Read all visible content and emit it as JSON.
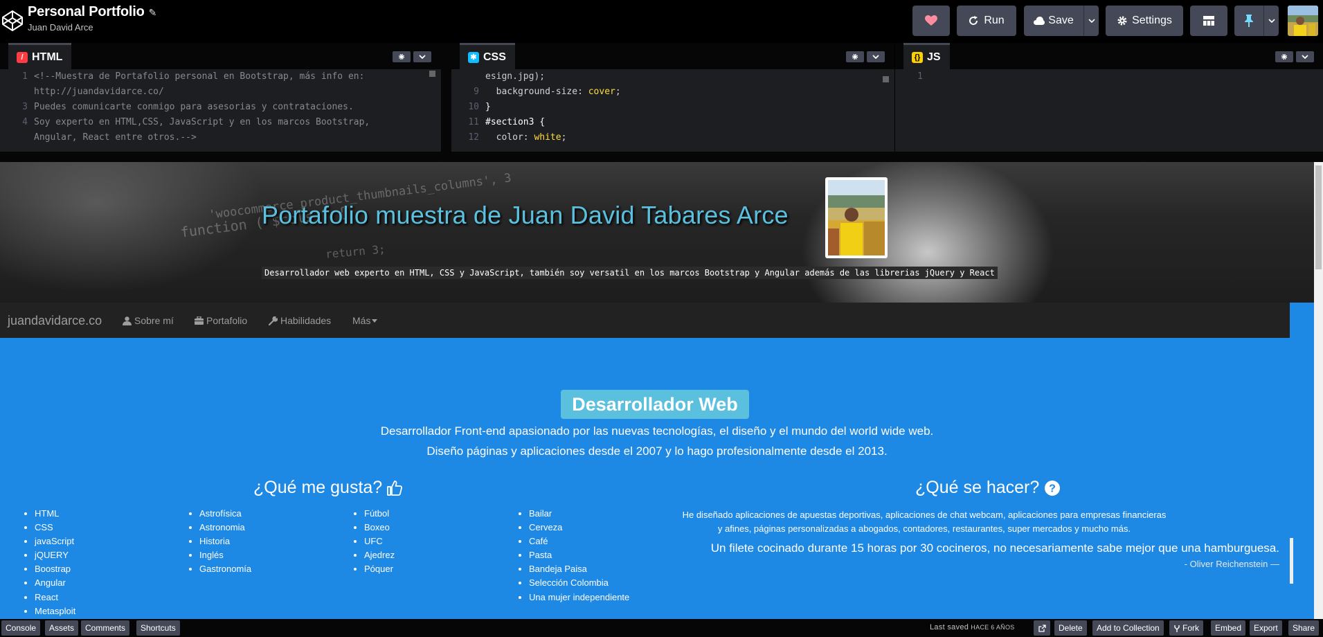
{
  "app": {
    "pen_title": "Personal Portfolio",
    "author": "Juan David Arce",
    "buttons": {
      "run": "Run",
      "save": "Save",
      "settings": "Settings"
    }
  },
  "editors": {
    "html": {
      "tab_label": "HTML",
      "lines": [
        {
          "num": "1",
          "text": "<!--Muestra de Portafolio personal en Bootstrap, más info en:"
        },
        {
          "num": "",
          "text": "http://juandavidarce.co/"
        },
        {
          "num": "3",
          "text": "Puedes comunicarte conmigo para asesorias y contrataciones."
        },
        {
          "num": "4",
          "text": "Soy experto en HTML,CSS, JavaScript y en los marcos Bootstrap,"
        },
        {
          "num": "",
          "text": "Angular, React entre otros.-->"
        }
      ]
    },
    "css": {
      "tab_label": "CSS",
      "lines": [
        {
          "num": "",
          "text": "esign.jpg);"
        },
        {
          "num": "9",
          "prop": "  background-size",
          "value": "cover"
        },
        {
          "num": "10",
          "text": "}"
        },
        {
          "num": "11",
          "text": "#section3 {"
        },
        {
          "num": "12",
          "prop": "  color",
          "value": "white"
        }
      ]
    },
    "js": {
      "tab_label": "JS",
      "lines": [
        {
          "num": "1",
          "text": ""
        }
      ]
    }
  },
  "preview": {
    "hero": {
      "title": "Portafolio muestra de Juan David Tabares Arce",
      "subtitle": "Desarrollador web experto en HTML, CSS y JavaScript, también soy versatil en los marcos Bootstrap y Angular además de las librerias jQuery y React"
    },
    "navbar": {
      "brand": "juandavidarce.co",
      "items": [
        {
          "label": "Sobre mí",
          "icon": "user-icon"
        },
        {
          "label": "Portafolio",
          "icon": "briefcase-icon"
        },
        {
          "label": "Habilidades",
          "icon": "wrench-icon"
        },
        {
          "label": "Más",
          "icon": "caret-down-icon"
        }
      ]
    },
    "section": {
      "badge": "Desarrollador Web",
      "intro_line1": "Desarrollador Front-end apasionado por las nuevas tecnologías, el diseño y el mundo del world wide web.",
      "intro_line2": "Diseño páginas y aplicaciones desde el 2007 y lo hago profesionalmente desde el 2013.",
      "likes_heading": "¿Qué me gusta?",
      "skills_heading": "¿Qué se hacer?",
      "list1": [
        "HTML",
        "CSS",
        "javaScript",
        "jQUERY",
        "Boostrap",
        "Angular",
        "React",
        "Metasploit"
      ],
      "list2": [
        "Astrofísica",
        "Astronomia",
        "Historia",
        "Inglés",
        "Gastronomía"
      ],
      "list3": [
        "Fútbol",
        "Boxeo",
        "UFC",
        "Ajedrez",
        "Póquer"
      ],
      "list4": [
        "Bailar",
        "Cerveza",
        "Café",
        "Pasta",
        "Bandeja Paisa",
        "Selección Colombia",
        "Una mujer independiente"
      ],
      "skills_desc": "He diseñado aplicaciones de apuestas deportivas, aplicaciones de chat webcam, aplicaciones para empresas financieras y afines, páginas personalizadas a abogados, contadores, restaurantes, super mercados y mucho más.",
      "quote": "Un filete cocinado durante 15 horas por 30 cocineros, no necesariamente sabe mejor que una hamburguesa.",
      "quote_author": "- Oliver Reichenstein  —"
    }
  },
  "footer": {
    "left_buttons": [
      "Console",
      "Assets",
      "Comments",
      "Shortcuts"
    ],
    "last_saved_label": "Last saved",
    "last_saved_value": "HACE 6 AÑOS",
    "right_buttons": {
      "delete": "Delete",
      "add_to_collection": "Add to Collection",
      "fork": "Fork",
      "embed": "Embed",
      "export": "Export",
      "share": "Share"
    }
  },
  "colors": {
    "accent_blue": "#1e88e5",
    "badge_blue": "#5bc0de",
    "toolbar_button": "#444857",
    "heart_pink": "#ff8da1",
    "pin_blue": "#76daff"
  }
}
